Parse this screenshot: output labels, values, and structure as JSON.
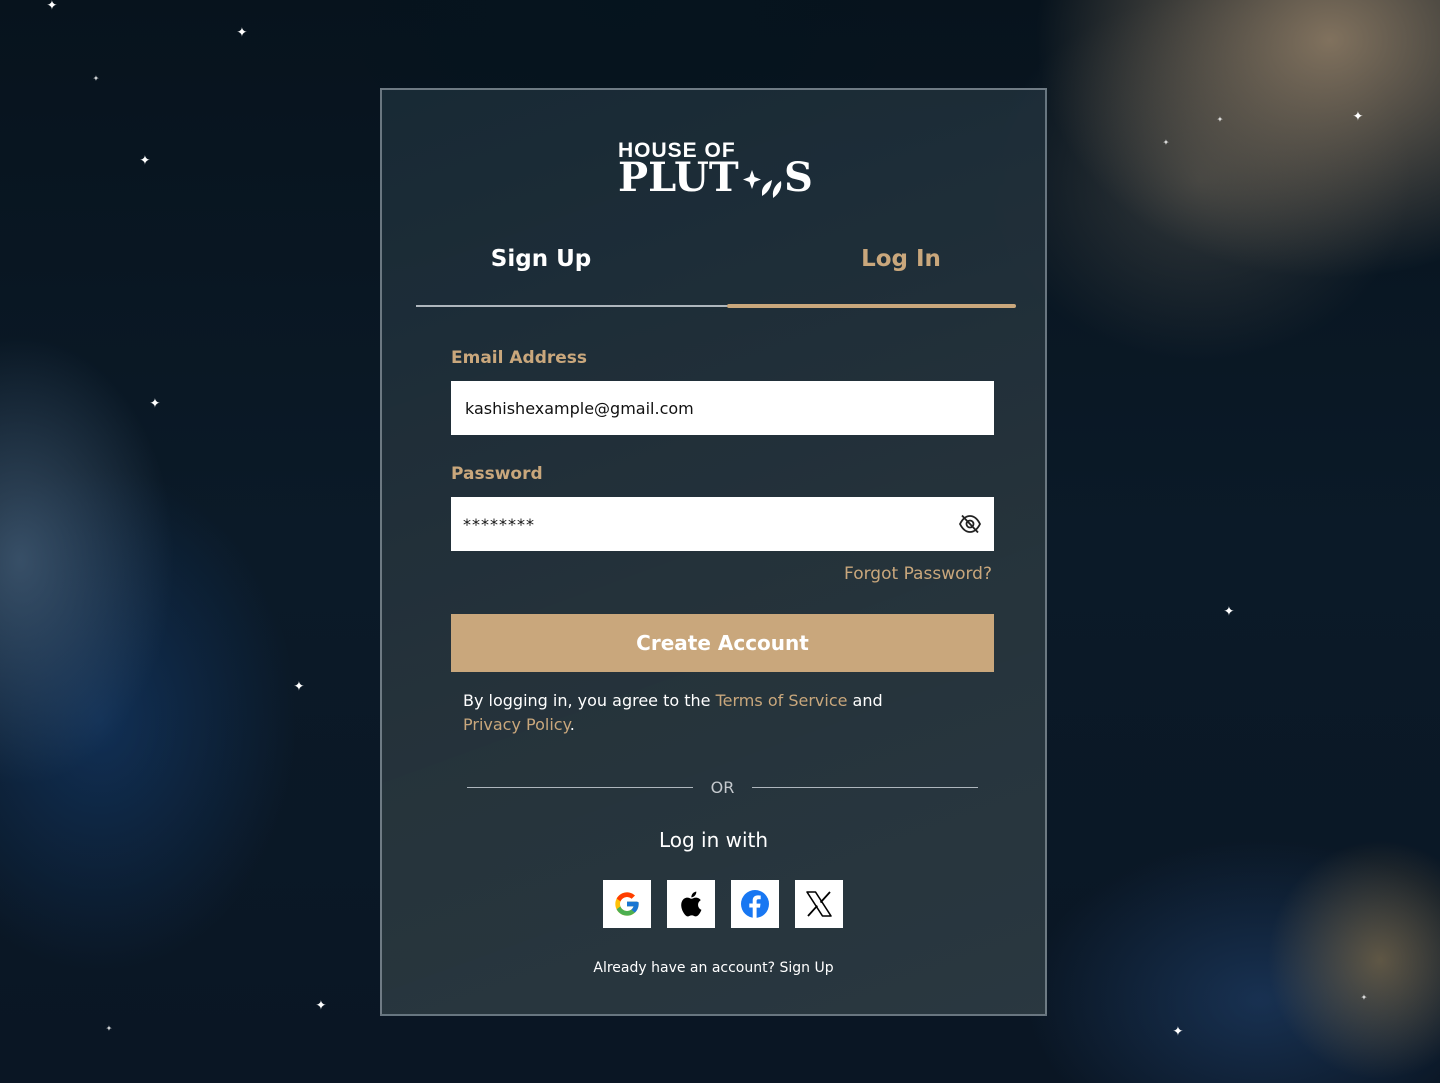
{
  "brand": {
    "line1": "HOUSE OF",
    "line2_prefix": "PLUT",
    "line2_suffix": "S"
  },
  "tabs": {
    "signup": "Sign Up",
    "login": "Log In",
    "active": "login"
  },
  "form": {
    "email_label": "Email Address",
    "email_value": "kashishexample@gmail.com",
    "password_label": "Password",
    "password_value": "********",
    "forgot": "Forgot Password?",
    "submit": "Create Account"
  },
  "legal": {
    "prefix": "By logging in, you agree to the ",
    "terms": "Terms of Service",
    "middle": " and",
    "privacy": "Privacy Policy",
    "suffix": "."
  },
  "divider": "OR",
  "social": {
    "heading": "Log in with",
    "providers": [
      "google",
      "apple",
      "facebook",
      "x"
    ]
  },
  "footer": {
    "prefix": "Already have an account? ",
    "link": "Sign Up"
  },
  "colors": {
    "accent": "#c9a77c",
    "card_border": "#aab4be",
    "text_light": "#ffffff"
  }
}
